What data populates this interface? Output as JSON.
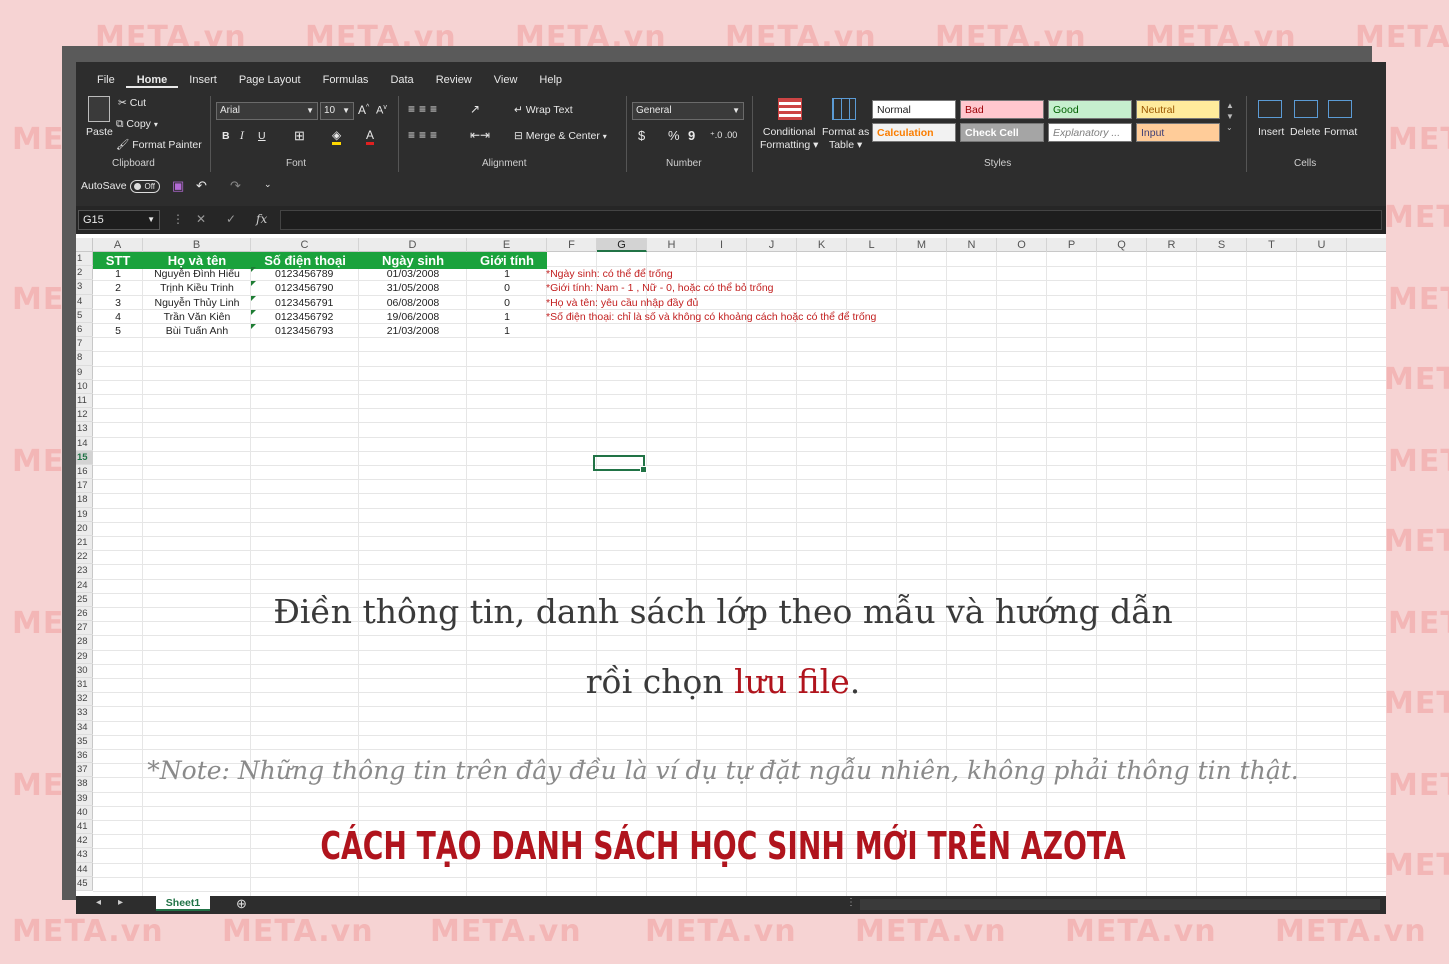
{
  "watermark": "META.vn",
  "ribbon": {
    "tabs": [
      "File",
      "Home",
      "Insert",
      "Page Layout",
      "Formulas",
      "Data",
      "Review",
      "View",
      "Help"
    ],
    "active_tab": "Home",
    "clipboard": {
      "paste": "Paste",
      "cut": "Cut",
      "copy": "Copy",
      "format_painter": "Format Painter",
      "label": "Clipboard"
    },
    "font": {
      "name": "Arial",
      "size": "10",
      "bold": "B",
      "italic": "I",
      "underline": "U",
      "label": "Font"
    },
    "alignment": {
      "wrap_text": "Wrap Text",
      "merge_center": "Merge & Center",
      "label": "Alignment"
    },
    "number": {
      "format": "General",
      "currency": "$",
      "percent": "%",
      "comma": "9",
      "label": "Number"
    },
    "styles": {
      "conditional_formatting": [
        "Conditional",
        "Formatting"
      ],
      "format_as_table": [
        "Format as",
        "Table"
      ],
      "cells": [
        {
          "label": "Normal",
          "bg": "#ffffff",
          "fg": "#222222"
        },
        {
          "label": "Bad",
          "bg": "#ffc7ce",
          "fg": "#9c0006"
        },
        {
          "label": "Good",
          "bg": "#c6efce",
          "fg": "#006100"
        },
        {
          "label": "Neutral",
          "bg": "#ffeb9c",
          "fg": "#9c5700"
        },
        {
          "label": "Calculation",
          "bg": "#f2f2f2",
          "fg": "#fa7d00"
        },
        {
          "label": "Check Cell",
          "bg": "#a5a5a5",
          "fg": "#ffffff"
        },
        {
          "label": "Explanatory ...",
          "bg": "#ffffff",
          "fg": "#7f7f7f"
        },
        {
          "label": "Input",
          "bg": "#ffcc99",
          "fg": "#3f3f76"
        }
      ],
      "label": "Styles"
    },
    "cells": {
      "insert": "Insert",
      "delete": "Delete",
      "format": "Format",
      "label": "Cells"
    }
  },
  "qat": {
    "autosave": "AutoSave",
    "toggle": "Off"
  },
  "formula_bar": {
    "name_box": "G15",
    "fx": "fx",
    "value": ""
  },
  "sheet": {
    "columns": [
      "A",
      "B",
      "C",
      "D",
      "E",
      "F",
      "G",
      "H",
      "I",
      "J",
      "K",
      "L",
      "M",
      "N",
      "O",
      "P",
      "Q",
      "R",
      "S",
      "T",
      "U"
    ],
    "selected_column": "G",
    "selected_row": "15",
    "headers": [
      "STT",
      "Họ và tên",
      "Số điện thoại",
      "Ngày sinh",
      "Giới tính"
    ],
    "rows": [
      [
        "1",
        "Nguyễn Đình Hiếu",
        "0123456789",
        "01/03/2008",
        "1"
      ],
      [
        "2",
        "Trịnh Kiều Trinh",
        "0123456790",
        "31/05/2008",
        "0"
      ],
      [
        "3",
        "Nguyễn Thủy Linh",
        "0123456791",
        "06/08/2008",
        "0"
      ],
      [
        "4",
        "Trần Văn Kiên",
        "0123456792",
        "19/06/2008",
        "1"
      ],
      [
        "5",
        "Bùi Tuấn Anh",
        "0123456793",
        "21/03/2008",
        "1"
      ]
    ],
    "notes": [
      "*Ngày sinh: có thể để trống",
      "*Giới tính: Nam - 1 , Nữ - 0, hoặc có thể bỏ trống",
      "*Họ và tên: yêu cầu nhập đầy đủ",
      "*Số điện thoại: chỉ là số và không có khoảng cách hoặc có thể để trống"
    ],
    "tab_name": "Sheet1"
  },
  "overlay": {
    "line1": "Điền thông tin, danh sách lớp theo mẫu và hướng dẫn",
    "line2_prefix": "rồi chọn ",
    "line2_highlight": "lưu file",
    "line2_suffix": ".",
    "note": "*Note: Những thông tin trên đây đều là ví dụ tự đặt ngẫu nhiên, không phải thông tin thật.",
    "title": "CÁCH TẠO DANH SÁCH HỌC SINH MỚI TRÊN AZOTA"
  },
  "colors": {
    "header_green": "#1aa23c",
    "note_red": "#c21f1f",
    "title_red": "#b0141d",
    "excel_green": "#217346"
  }
}
